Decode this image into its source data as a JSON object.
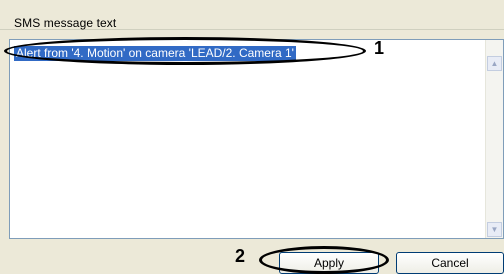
{
  "group": {
    "label": "SMS message text"
  },
  "message": {
    "selected_text": "Alert from '4. Motion' on camera 'LEAD/2. Camera 1'"
  },
  "scrollbar": {
    "up_arrow_glyph": "▲",
    "down_arrow_glyph": "▼"
  },
  "callouts": {
    "one": "1",
    "two": "2"
  },
  "buttons": {
    "apply_label": "Apply",
    "cancel_label": "Cancel"
  }
}
